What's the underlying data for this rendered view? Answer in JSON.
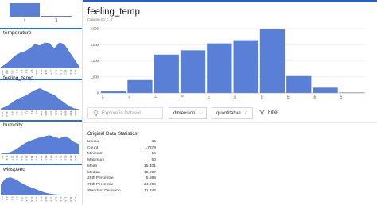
{
  "sidebar": {
    "top_card": {
      "ticks": [
        "no",
        "yes"
      ],
      "values": [
        0.85,
        0.05
      ]
    },
    "cards": [
      {
        "label": "temperature",
        "ticks": [
          "-7.00",
          "-5.9",
          "-2.0",
          "0.9",
          "3.8",
          "6.8",
          "9.7",
          "12.6",
          "15.6",
          "18.5",
          "21.4",
          "24.4",
          "27.3",
          "30.2",
          "33.2",
          "36.1",
          "39.0"
        ]
      },
      {
        "label": "feeling_temp",
        "ticks": [
          "-16.0",
          "-12.4",
          "-8.8",
          "-5.2",
          "-1.6",
          "2.0",
          "5.6",
          "9.2",
          "12.8",
          "16.4",
          "20.0",
          "23.6",
          "27.2",
          "30.8",
          "34.4",
          "38.0",
          "41.6"
        ]
      },
      {
        "label": "humidity",
        "ticks": [
          "6.0",
          "11.9",
          "17.7",
          "23.6",
          "29.4",
          "35.3",
          "41.1",
          "47.0",
          "52.8",
          "58.7",
          "64.5",
          "70.4",
          "76.2",
          "82.1",
          "87.9",
          "93.8",
          "99.6"
        ]
      },
      {
        "label": "winspeed",
        "ticks": [
          "0.0",
          "2.9",
          "5.8",
          "8.6",
          "11.5",
          "14.4",
          "17.3",
          "20.2",
          "23.0",
          "25.9",
          "28.8",
          "31.7",
          "34.6",
          "37.4",
          "40.3",
          "43.2",
          "46.1"
        ]
      }
    ]
  },
  "main": {
    "title": "feeling_temp",
    "column_id": "Column ID: c_7",
    "explore_label": "Explore in Dataset",
    "dimension_label": "dimension",
    "quantitative_label": "quantitative",
    "filter_label": "Filter",
    "stats": {
      "title": "Original Data Statistics",
      "rows": [
        {
          "label": "Unique",
          "value": "65"
        },
        {
          "label": "Count",
          "value": "17379"
        },
        {
          "label": "Minimum",
          "value": "-16"
        },
        {
          "label": "Maximum",
          "value": "50"
        },
        {
          "label": "Mean",
          "value": "15.401"
        },
        {
          "label": "Median",
          "value": "15.997"
        },
        {
          "label": "25th Percentile",
          "value": "5.998"
        },
        {
          "label": "75th Percentile",
          "value": "24.999"
        },
        {
          "label": "Standard Deviation",
          "value": "11.342"
        }
      ]
    }
  },
  "chart_data": {
    "type": "bar",
    "categories": [
      "-16",
      "-9",
      "-2",
      "5",
      "12",
      "19",
      "26",
      "33",
      "40",
      "47"
    ],
    "values": [
      120,
      800,
      2380,
      2650,
      3080,
      3280,
      3970,
      1050,
      330,
      30
    ],
    "yticks": [
      "0",
      "1,000",
      "2,000",
      "3,000",
      "4,000"
    ],
    "ylim": [
      0,
      4000
    ],
    "grid": true,
    "color": "#5a7fd6"
  },
  "colors": {
    "accent": "#2b6fd6",
    "bar": "#5a7fd6",
    "area": "#5b7fd7"
  },
  "icons": {
    "explore": "lightbulb-icon",
    "filter": "filter-icon",
    "caret": "chevron-down-icon"
  }
}
